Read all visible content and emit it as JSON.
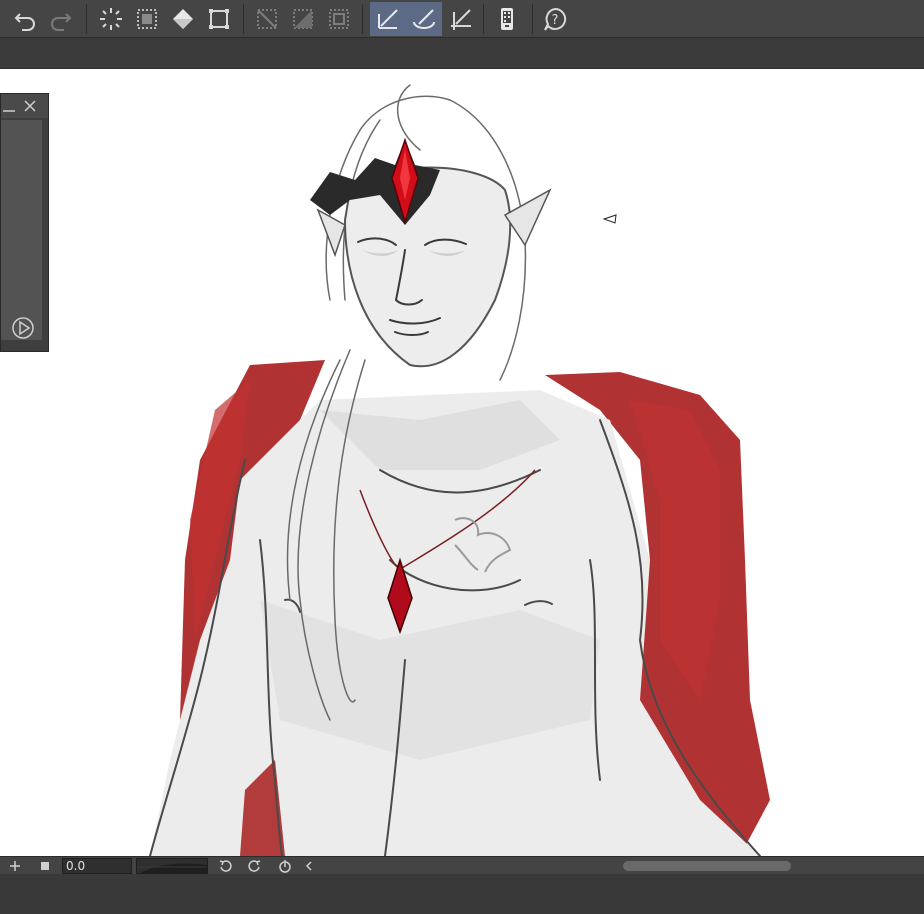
{
  "app": {
    "accent": "#5d6a86",
    "canvas_bg": "#ffffff",
    "chrome_bg": "#454545"
  },
  "toolbar": {
    "buttons": [
      {
        "icon": "undo-icon"
      },
      {
        "icon": "redo-icon"
      },
      {
        "icon": "clear-selection-icon"
      },
      {
        "icon": "select-all-icon"
      },
      {
        "icon": "fill-icon"
      },
      {
        "icon": "transform-icon"
      },
      {
        "icon": "deselect-icon"
      },
      {
        "icon": "invert-selection-icon"
      },
      {
        "icon": "selection-border-icon"
      },
      {
        "icon": "snap-ruler-icon",
        "active": true
      },
      {
        "icon": "snap-special-ruler-icon",
        "active": true
      },
      {
        "icon": "snap-grid-icon"
      },
      {
        "icon": "device-icon"
      },
      {
        "icon": "help-icon"
      }
    ]
  },
  "bottombar": {
    "zoom_value": "0.0",
    "buttons": [
      "add-icon",
      "stop-icon",
      "rotate-left-icon",
      "rotate-right-icon",
      "reset-rotation-icon",
      "collapse-left-icon"
    ]
  },
  "panel": {
    "controls": [
      "minimize-icon",
      "close-icon"
    ],
    "play_icon": "play-icon"
  }
}
